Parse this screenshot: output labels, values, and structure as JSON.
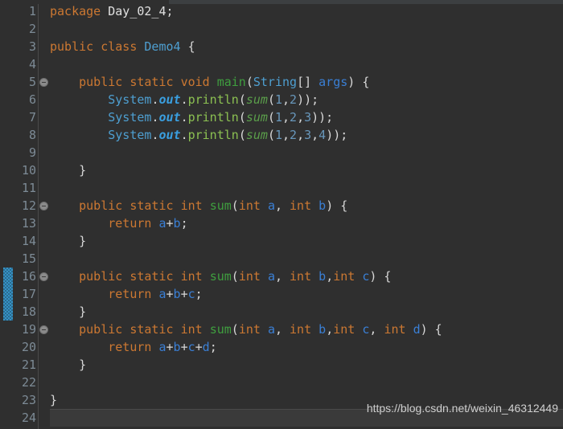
{
  "editor": {
    "language": "Java",
    "theme": "dark",
    "background_color": "#2f2f2f",
    "gutter_text_color": "#7d8b96",
    "caret_line_number": 24,
    "change_marker_lines": [
      16,
      17,
      18
    ],
    "fold_marker_lines": [
      5,
      12,
      16,
      19
    ],
    "line_numbers": [
      "1",
      "2",
      "3",
      "4",
      "5",
      "6",
      "7",
      "8",
      "9",
      "10",
      "11",
      "12",
      "13",
      "14",
      "15",
      "16",
      "17",
      "18",
      "19",
      "20",
      "21",
      "22",
      "23",
      "24"
    ],
    "lines": [
      {
        "n": 1,
        "text": "package Day_02_4;"
      },
      {
        "n": 2,
        "text": ""
      },
      {
        "n": 3,
        "text": "public class Demo4 {"
      },
      {
        "n": 4,
        "text": ""
      },
      {
        "n": 5,
        "text": "    public static void main(String[] args) {"
      },
      {
        "n": 6,
        "text": "        System.out.println(sum(1,2));"
      },
      {
        "n": 7,
        "text": "        System.out.println(sum(1,2,3));"
      },
      {
        "n": 8,
        "text": "        System.out.println(sum(1,2,3,4));"
      },
      {
        "n": 9,
        "text": ""
      },
      {
        "n": 10,
        "text": "    }"
      },
      {
        "n": 11,
        "text": ""
      },
      {
        "n": 12,
        "text": "    public static int sum(int a, int b) {"
      },
      {
        "n": 13,
        "text": "        return a+b;"
      },
      {
        "n": 14,
        "text": "    }"
      },
      {
        "n": 15,
        "text": ""
      },
      {
        "n": 16,
        "text": "    public static int sum(int a, int b,int c) {"
      },
      {
        "n": 17,
        "text": "        return a+b+c;"
      },
      {
        "n": 18,
        "text": "    }"
      },
      {
        "n": 19,
        "text": "    public static int sum(int a, int b,int c, int d) {"
      },
      {
        "n": 20,
        "text": "        return a+b+c+d;"
      },
      {
        "n": 21,
        "text": "    }"
      },
      {
        "n": 22,
        "text": ""
      },
      {
        "n": 23,
        "text": "}"
      },
      {
        "n": 24,
        "text": ""
      }
    ]
  },
  "watermark": {
    "text": "https://blog.csdn.net/weixin_46312449"
  },
  "colors": {
    "keyword": "#cc7832",
    "class_name": "#4e9fd1",
    "method_decl": "#3f9f3f",
    "method_call": "#5a9e4a",
    "println": "#8cc152",
    "field": "#3a9fe0",
    "number": "#6897bb",
    "variable": "#3a7fd5",
    "punctuation": "#d8d8d8",
    "change_marker": "#3592c4",
    "caret_line_bg": "#3a3a3a"
  }
}
